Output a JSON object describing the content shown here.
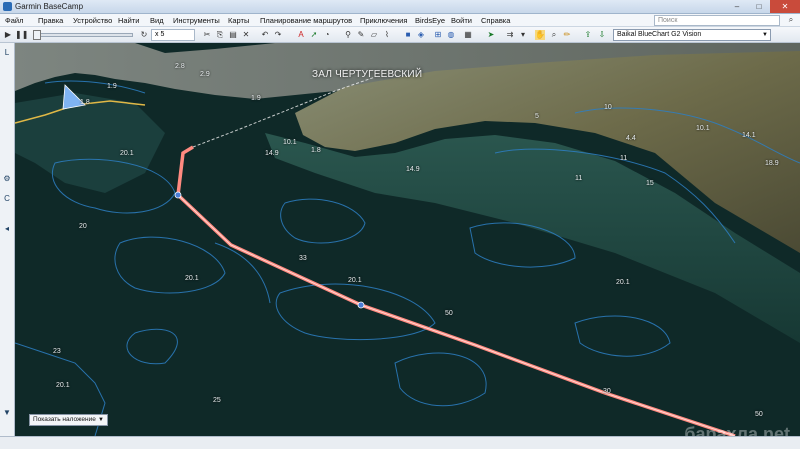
{
  "window": {
    "title": "Garmin BaseCamp",
    "minimize": "–",
    "maximize": "□",
    "close": "✕"
  },
  "menu": [
    "Файл",
    "Правка",
    "Устройство",
    "Найти",
    "Вид",
    "Инструменты",
    "Карты",
    "Планирование маршрутов",
    "Приключения",
    "BirdsEye",
    "Войти",
    "Справка"
  ],
  "search": {
    "placeholder": "Поиск"
  },
  "toolbar": {
    "zoom_value": "x 5",
    "map_product": "Baikal BlueChart G2 Vision",
    "icons": [
      "play-icon",
      "pause-icon",
      "undo-icon",
      "redo-icon",
      "scissors-icon",
      "text-icon",
      "route-icon",
      "waypoint-icon",
      "measure-icon",
      "erase-icon",
      "track-icon",
      "map-view-icon",
      "3d-view-icon",
      "grid-icon",
      "globe-icon",
      "pin-icon",
      "route-tool-icon",
      "hand-icon",
      "zoom-icon",
      "ruler-icon",
      "send-device-icon",
      "receive-device-icon"
    ]
  },
  "map": {
    "bay_label": "ЗАЛ ЧЕРТУГЕЕВСКИЙ",
    "overlay_button": "Показать наложение",
    "depth_labels": [
      {
        "text": "1.9"
      },
      {
        "text": "1.8"
      },
      {
        "text": "2.9"
      },
      {
        "text": "2.8"
      },
      {
        "text": "1.9"
      },
      {
        "text": "20.1"
      },
      {
        "text": "10.1"
      },
      {
        "text": "1.8"
      },
      {
        "text": "14.9"
      },
      {
        "text": "14.9"
      },
      {
        "text": "5"
      },
      {
        "text": "10"
      },
      {
        "text": "4.4"
      },
      {
        "text": "10.1"
      },
      {
        "text": "14.1"
      },
      {
        "text": "11"
      },
      {
        "text": "11"
      },
      {
        "text": "15"
      },
      {
        "text": "18.9"
      },
      {
        "text": "20"
      },
      {
        "text": "33"
      },
      {
        "text": "20.1"
      },
      {
        "text": "20.1"
      },
      {
        "text": "50"
      },
      {
        "text": "23"
      },
      {
        "text": "20.1"
      },
      {
        "text": "20.1"
      },
      {
        "text": "25"
      },
      {
        "text": "30"
      },
      {
        "text": "50"
      }
    ]
  },
  "watermark": "барахла.net"
}
